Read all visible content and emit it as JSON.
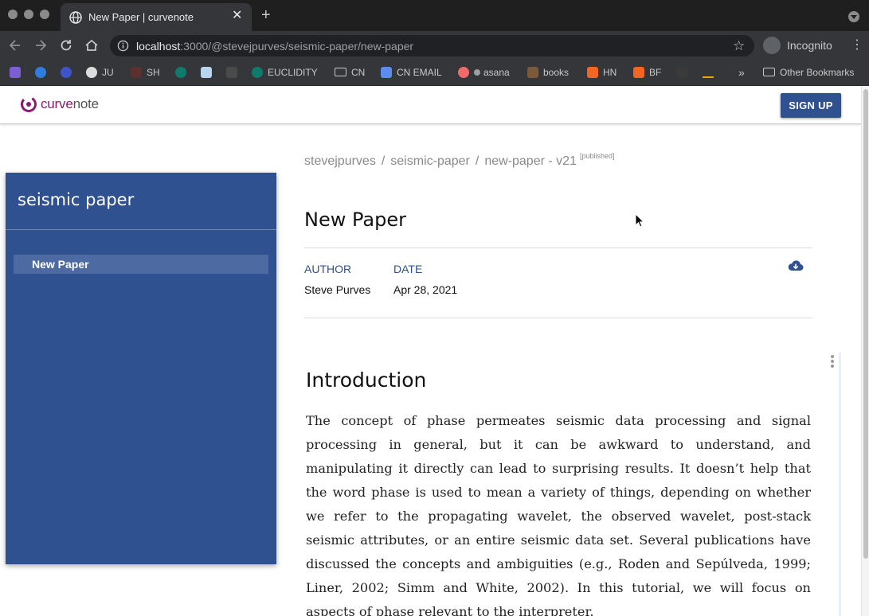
{
  "browser": {
    "tab_title": "New Paper | curvenote",
    "url_host": "localhost",
    "url_rest": ":3000/@stevejpurves/seismic-paper/new-paper",
    "profile_label": "Incognito",
    "bookmarks": [
      "JU",
      "SH",
      "EUCLIDITY",
      "CN",
      "CN EMAIL",
      "asana",
      "books",
      "HN",
      "BF"
    ],
    "other_bookmarks": "Other Bookmarks",
    "more_glyph": "»"
  },
  "app": {
    "logo_prefix": "curve",
    "logo_suffix": "note",
    "signup_label": "SIGN UP",
    "accent_color": "#30518f"
  },
  "sidebar": {
    "project_title": "seismic paper",
    "items": [
      {
        "label": "New Paper",
        "active": true
      }
    ]
  },
  "breadcrumb": {
    "owner": "stevejpurves",
    "project": "seismic-paper",
    "document": "new-paper - v21",
    "status": "[published]",
    "separator": "/"
  },
  "document": {
    "title": "New Paper",
    "author_label": "AUTHOR",
    "author": "Steve Purves",
    "date_label": "DATE",
    "date": "Apr 28, 2021",
    "section_heading": "Introduction",
    "paragraph": "The concept of phase permeates seismic data processing and signal processing in general, but it can be awkward to understand, and manipulating it directly can lead to surprising results. It doesn’t help that the word phase is used to mean a variety of things, depending on whether we refer to the propagating wavelet, the observed wavelet, post-stack seismic attributes, or an entire seismic data set. Several publications have discussed the concepts and ambiguities (e.g., Roden and Sepúlveda, 1999; Liner, 2002; Simm and White, 2002). In this tutorial, we will focus on aspects of phase relevant to the interpreter."
  },
  "icons": {
    "download": "cloud-download-icon",
    "block_menu": "more-vertical-icon"
  }
}
